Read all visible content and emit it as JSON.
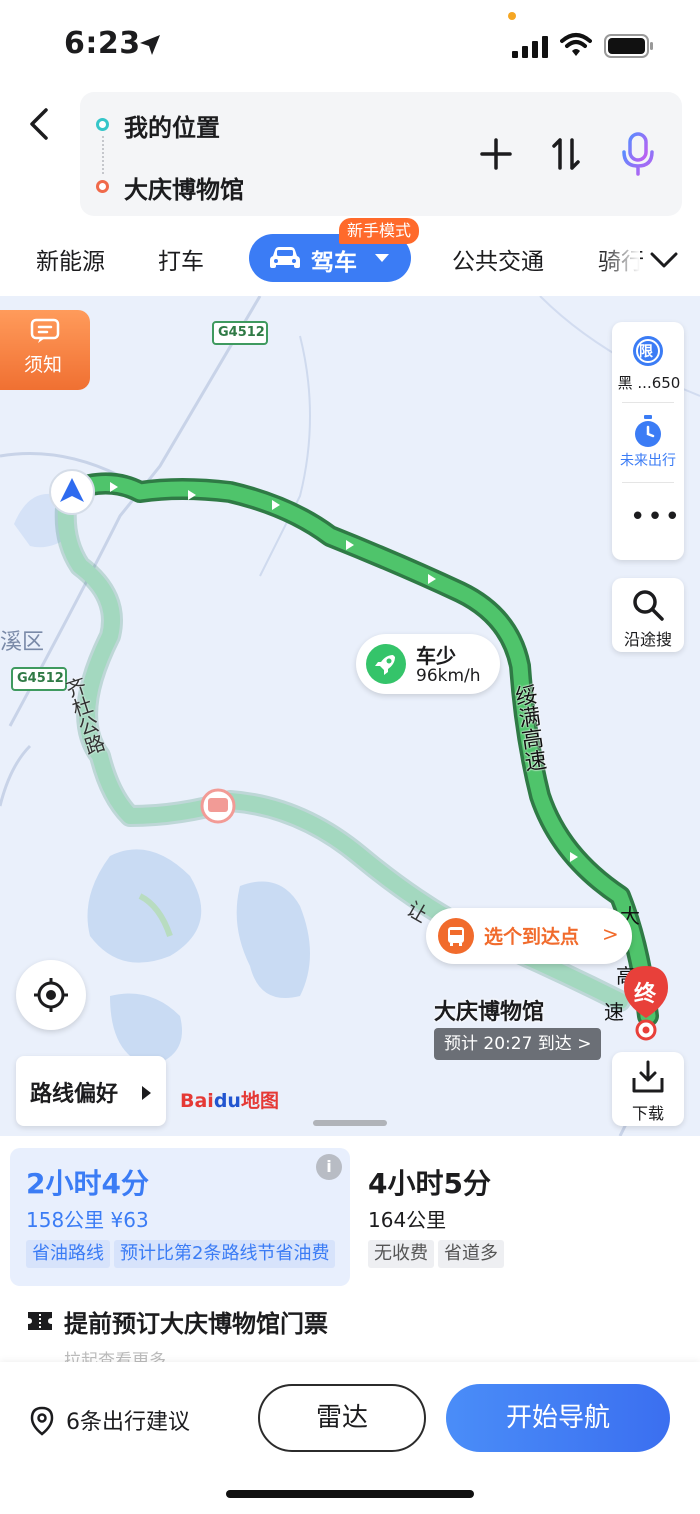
{
  "status_bar": {
    "time": "6:23"
  },
  "search": {
    "origin": "我的位置",
    "destination": "大庆博物馆"
  },
  "modes": {
    "items": [
      "新能源",
      "打车",
      "公共交通",
      "骑行"
    ],
    "active": "驾车",
    "badge": "新手模式"
  },
  "map": {
    "notice_label": "须知",
    "limit_label": "黑 ...650",
    "limit_icon_text": "限",
    "future_travel_label": "未来出行",
    "along_search_label": "沿途搜",
    "preference_label": "路线偏好",
    "download_label": "下载",
    "logo_bai": "Bai",
    "logo_du": "du",
    "logo_map": "地图",
    "traffic_bubble": {
      "title": "车少",
      "speed": "96km/h"
    },
    "pick_arrival": "选个到达点",
    "destination_label": "大庆博物馆",
    "eta": "预计 20:27 到达 >",
    "end_marker": "终",
    "road_labels": {
      "highway_code": "G4512",
      "district": "昂溪区",
      "road_qidu": "齐杜公路",
      "road_suiman": "绥满高速",
      "road_rang": "让",
      "road_da": "大",
      "road_gao": "高",
      "road_su": "速"
    }
  },
  "routes": [
    {
      "duration": "2小时4分",
      "distance": "158公里 ¥63",
      "tags": [
        "省油路线",
        "预计比第2条路线节省油费"
      ],
      "selected": true
    },
    {
      "duration": "4小时5分",
      "distance": "164公里",
      "tags": [
        "无收费",
        "省道多"
      ],
      "selected": false
    }
  ],
  "ticket": {
    "text": "提前预订大庆博物馆门票"
  },
  "expand_hint": "拉起查看更多",
  "bottom": {
    "suggestions": "6条出行建议",
    "radar": "雷达",
    "navigate": "开始导航"
  },
  "colors": {
    "accent": "#3b7cf5",
    "route_main": "#3fae5b",
    "route_alt": "#9fd4b8",
    "orange": "#f16b2c"
  }
}
